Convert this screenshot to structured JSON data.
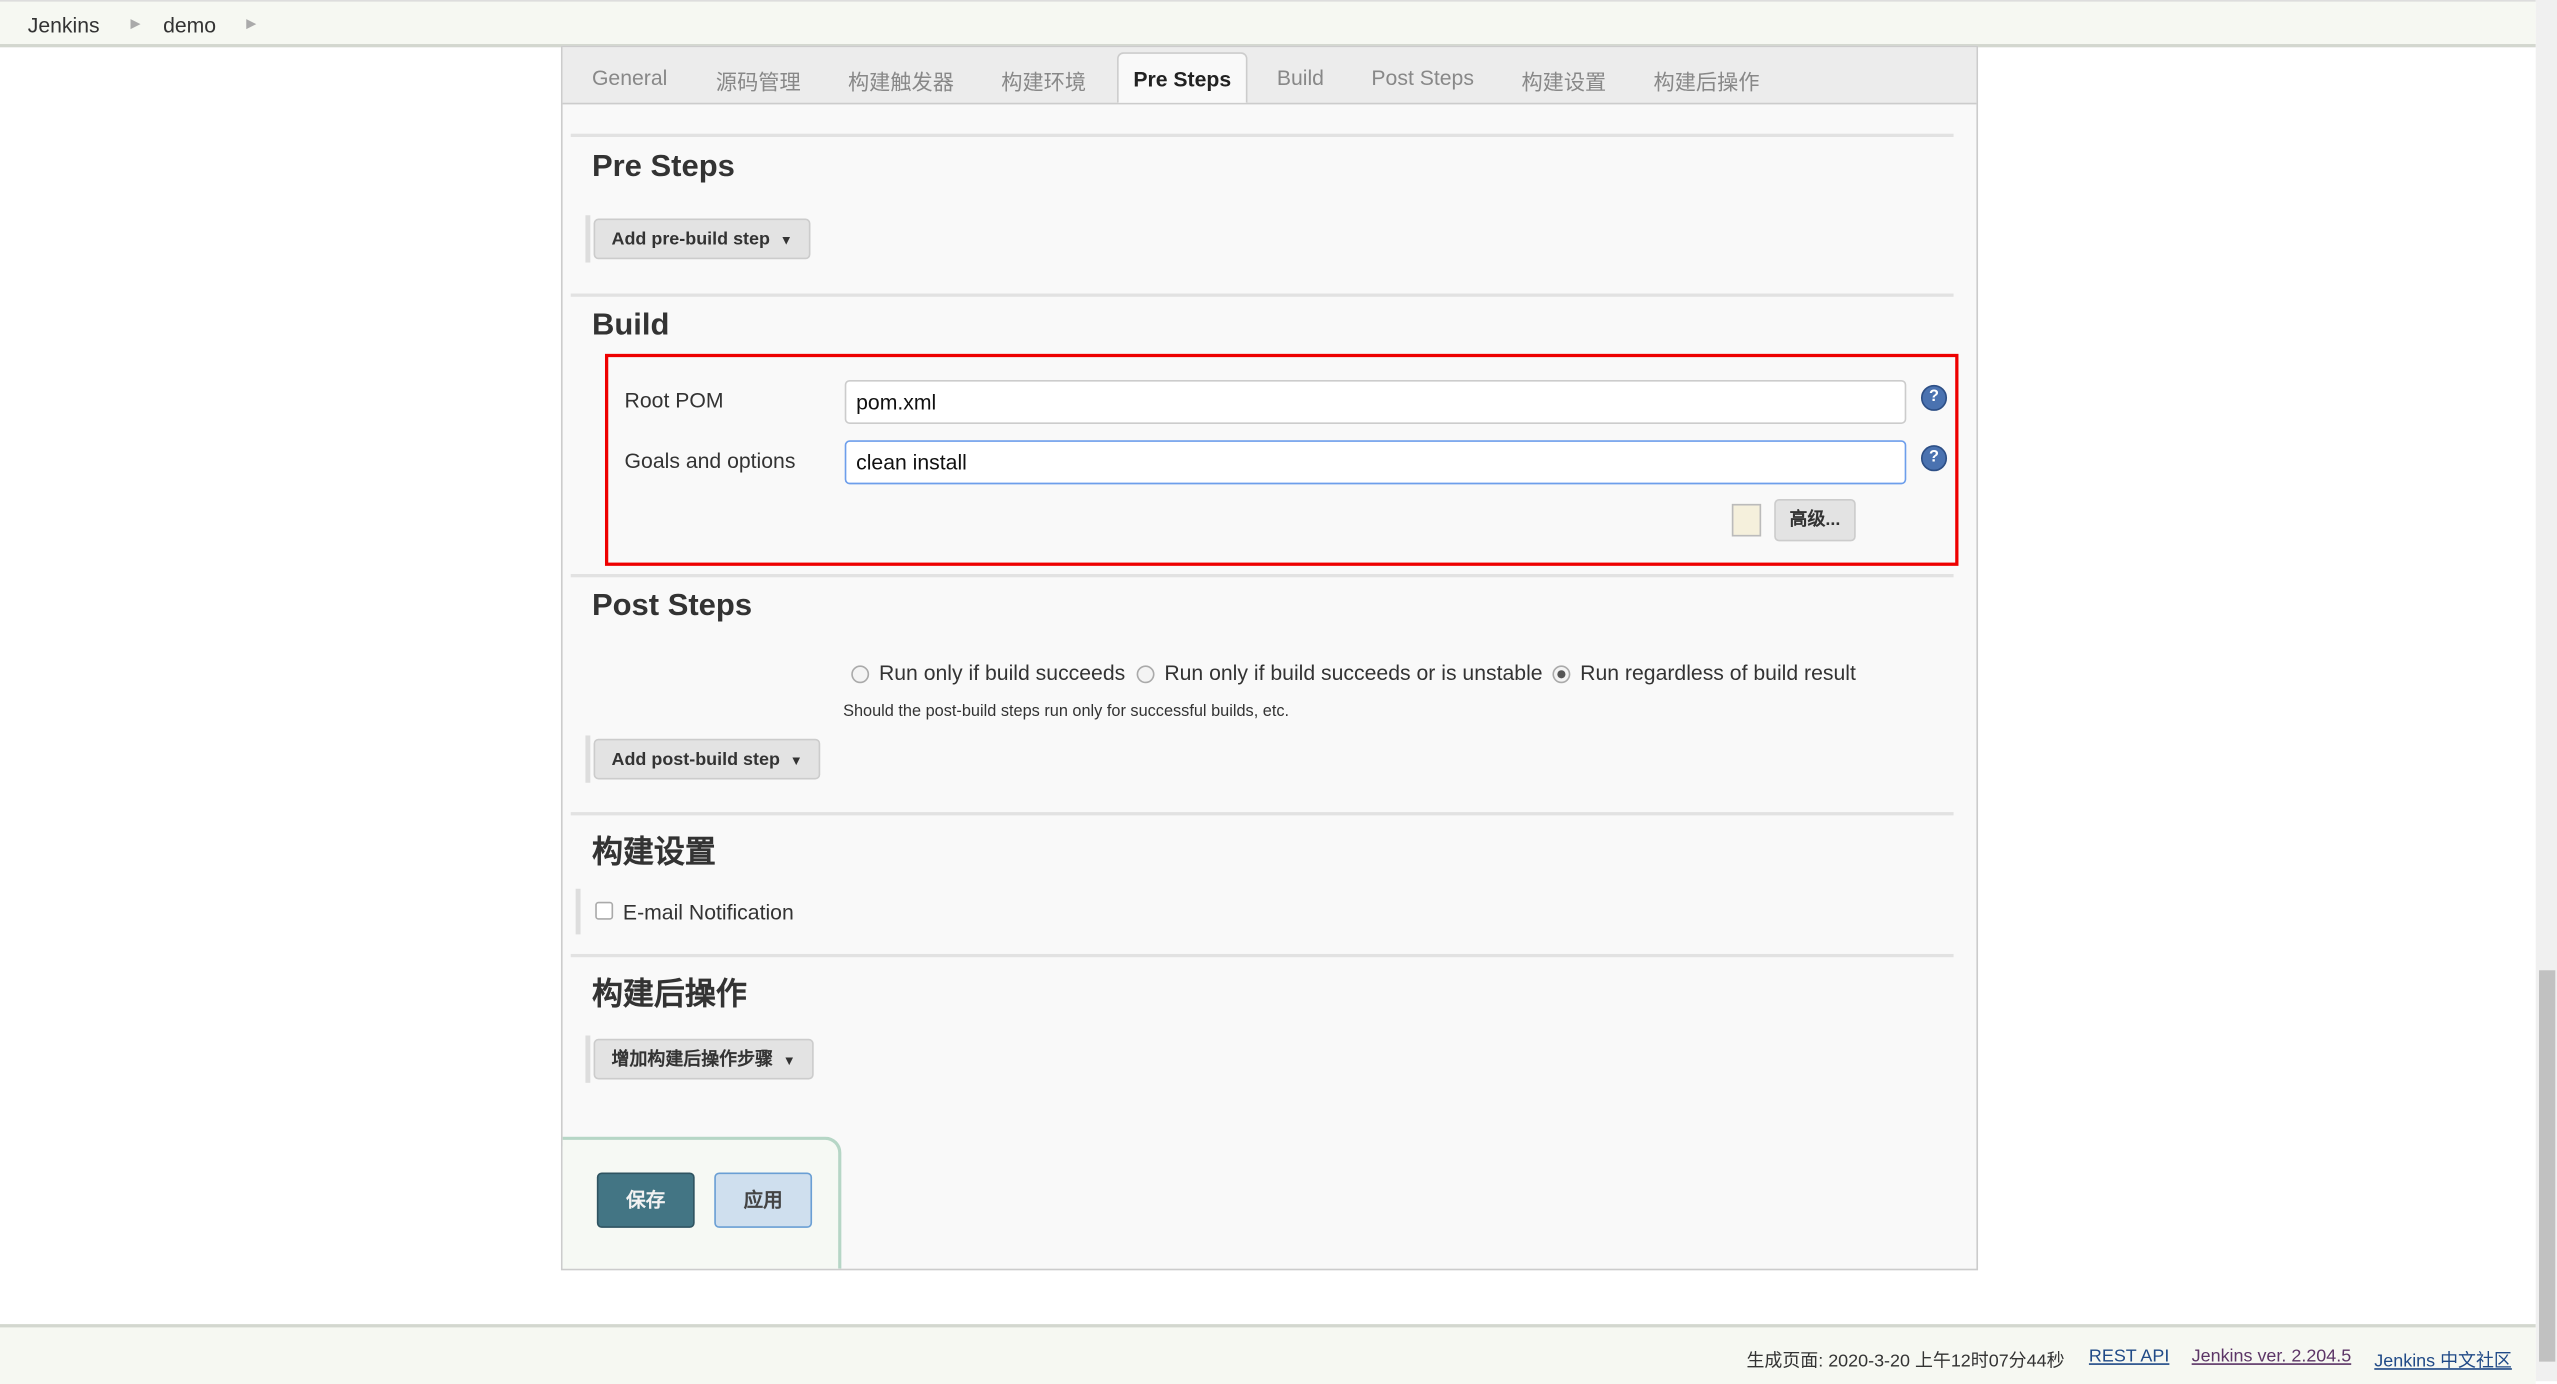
{
  "breadcrumbs": [
    "Jenkins",
    "demo"
  ],
  "tabs": [
    {
      "label": "General"
    },
    {
      "label": "源码管理"
    },
    {
      "label": "构建触发器"
    },
    {
      "label": "构建环境"
    },
    {
      "label": "Pre Steps",
      "active": true
    },
    {
      "label": "Build"
    },
    {
      "label": "Post Steps"
    },
    {
      "label": "构建设置"
    },
    {
      "label": "构建后操作"
    }
  ],
  "pre_steps": {
    "title": "Pre Steps",
    "add_button": "Add pre-build step"
  },
  "build": {
    "title": "Build",
    "root_pom_label": "Root POM",
    "root_pom_value": "pom.xml",
    "goals_label": "Goals and options",
    "goals_value": "clean install",
    "advanced_button": "高级...",
    "help_icon": "?"
  },
  "post_steps": {
    "title": "Post Steps",
    "options": [
      {
        "label": "Run only if build succeeds",
        "selected": false
      },
      {
        "label": "Run only if build succeeds or is unstable",
        "selected": false
      },
      {
        "label": "Run regardless of build result",
        "selected": true
      }
    ],
    "hint": "Should the post-build steps run only for successful builds, etc.",
    "add_button": "Add post-build step"
  },
  "build_settings": {
    "title": "构建设置",
    "email_label": "E-mail Notification",
    "email_checked": false
  },
  "post_build": {
    "title": "构建后操作",
    "add_button": "增加构建后操作步骤"
  },
  "actions": {
    "save": "保存",
    "apply": "应用"
  },
  "footer": {
    "generated": "生成页面: 2020-3-20 上午12时07分44秒",
    "rest_api": "REST API",
    "version": "Jenkins ver. 2.204.5",
    "community": "Jenkins 中文社区"
  },
  "colors": {
    "highlight_border": "#ee0000",
    "save_bg": "#437584",
    "apply_bg": "#cfdfee"
  }
}
